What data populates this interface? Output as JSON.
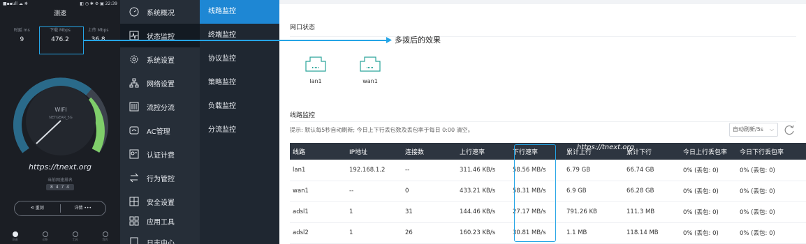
{
  "phone": {
    "status_left": "■▪▪ull ☁ ❋",
    "status_right": "◧ ◷ ✱ ⚙ ▣ 22:39",
    "title": "测速",
    "stats": [
      {
        "label": "时延 ms",
        "value": "9"
      },
      {
        "label": "下载 Mbps",
        "value": "476.2"
      },
      {
        "label": "上传 Mbps",
        "value": "36.8"
      }
    ],
    "dial_label": "WIFI",
    "dial_sub": "NETGEAR_5G",
    "url": "https://tnext.org",
    "rank_label": "当前网速排名",
    "rank_value": "8 4 7 4",
    "btn_retest": "重测",
    "btn_detail": "详情 •••",
    "tabs": [
      "测速",
      "诊断",
      "工具",
      "我的"
    ]
  },
  "nav": [
    {
      "label": "系统概况",
      "icon": "speedometer-icon"
    },
    {
      "label": "状态监控",
      "icon": "pulse-icon"
    },
    {
      "label": "系统设置",
      "icon": "gear-icon"
    },
    {
      "label": "网络设置",
      "icon": "network-icon"
    },
    {
      "label": "流控分流",
      "icon": "sliders-icon"
    },
    {
      "label": "AC管理",
      "icon": "router-icon"
    },
    {
      "label": "认证计费",
      "icon": "auth-icon"
    },
    {
      "label": "行为管控",
      "icon": "arrows-icon"
    },
    {
      "label": "安全设置",
      "icon": "shield-grid-icon"
    },
    {
      "label": "应用工具",
      "icon": "apps-icon"
    },
    {
      "label": "日志中心",
      "icon": "log-icon"
    }
  ],
  "subnav": [
    "线路监控",
    "终端监控",
    "协议监控",
    "策略监控",
    "负载监控",
    "分流监控"
  ],
  "content": {
    "port_status_title": "网口状态",
    "ports": [
      "lan1",
      "wan1"
    ],
    "line_monitor_title": "线路监控",
    "hint": "提示: 默认每5秒自动刷新; 今日上下行丢包数及丢包率于每日 0:00 清空。",
    "refresh_select": "自动刷新/5s",
    "columns": [
      "线路",
      "IP地址",
      "连接数",
      "上行速率",
      "下行速率",
      "累计上行",
      "累计下行",
      "今日上行丢包率",
      "今日下行丢包率"
    ],
    "rows": [
      [
        "lan1",
        "192.168.1.2",
        "--",
        "311.46 KB/s",
        "58.56 MB/s",
        "6.79 GB",
        "66.74 GB",
        "0% (丢包: 0)",
        "0% (丢包: 0)"
      ],
      [
        "wan1",
        "--",
        "0",
        "433.21 KB/s",
        "58.31 MB/s",
        "6.9 GB",
        "66.28 GB",
        "0% (丢包: 0)",
        "0% (丢包: 0)"
      ],
      [
        "adsl1",
        "1",
        "31",
        "144.46 KB/s",
        "27.17 MB/s",
        "791.26 KB",
        "111.3 MB",
        "0% (丢包: 0)",
        "0% (丢包: 0)"
      ],
      [
        "adsl2",
        "1",
        "26",
        "160.23 KB/s",
        "30.81 MB/s",
        "1.1 MB",
        "118.14 MB",
        "0% (丢包: 0)",
        "0% (丢包: 0)"
      ]
    ]
  },
  "annotation": {
    "text": "多拨后的效果",
    "watermark": "https://tnext.org"
  },
  "colors": {
    "accent": "#1e87d4",
    "annotation": "#25a5e6",
    "sidebar": "#262e38"
  }
}
